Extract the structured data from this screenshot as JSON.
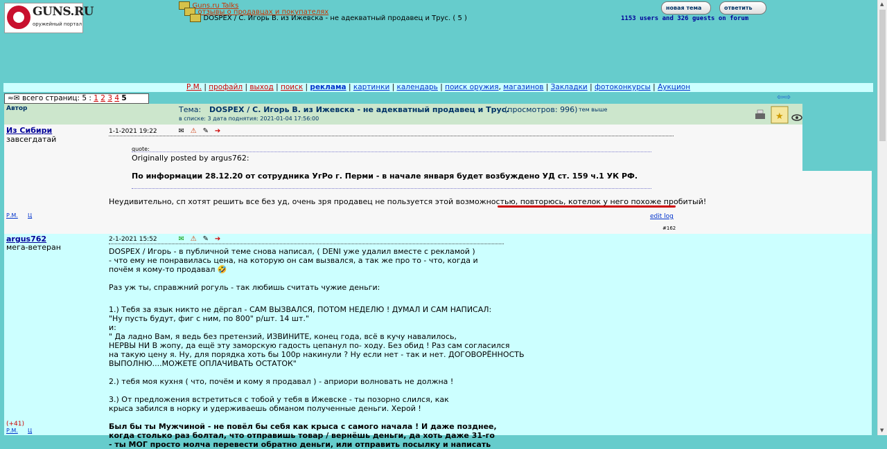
{
  "logo": {
    "brand": "GUNS.RU",
    "tagline": "оружейный портал"
  },
  "breadcrumb": {
    "level1": "Guns.ru Talks",
    "level2": "отзывы о продавцах и покупателях",
    "level3": "DOSPEX / С. Игорь В. из Ижевска - не адекватный продавец и Трус. ( 5 )"
  },
  "header_buttons": {
    "new_topic": "новая тема",
    "reply": "ответить"
  },
  "online": "1153 users and 326 guests on forum",
  "nav": [
    "Р.М.",
    "профайл",
    "выход",
    "поиск",
    "реклама",
    "картинки",
    "календарь",
    "поиск оружия",
    "магазинов",
    "Закладки",
    "фотоконкурсы",
    "Аукцион"
  ],
  "pages": {
    "label": "всего страниц: 5 :",
    "links": [
      "1",
      "2",
      "3",
      "4"
    ],
    "current": "5"
  },
  "topic": {
    "author_col": "Автор",
    "label": "Тема:",
    "title": "DOSPEX / С. Игорь В. из Ижевска - не адекватный продавец и Трус.",
    "views": "(просмотров: 996)",
    "above": "тем выше",
    "meta": "в списке: 3 дата поднятия: 2021-01-04 17:56:00"
  },
  "post1": {
    "author": "Из Сибири",
    "rank": "завсегдатай",
    "date": "1-1-2021 19:22",
    "quote_label": "quote:",
    "quote_by": "Originally posted by argus762:",
    "quote_text": "По информации 28.12.20 от сотрудника УгРо г. Перми - в начале января будет возбуждено УД ст. 159 ч.1 УК РФ.",
    "text_a": "Неудивительно, сп хотят решить все без уд, очень зря продавец не пользуется этой возможностью, ",
    "text_b": "повторюсь, котелок у него похоже пробитый!",
    "edit_log": "edit log",
    "num": "#162",
    "pm": "Р.М.",
    "cite": "Ц"
  },
  "post2": {
    "author": "argus762",
    "rank": "мега-ветеран",
    "date": "2-1-2021 15:52",
    "p1": "DOSPEX / Игорь - в публичной теме снова написал, ( DENI уже удалил вместе с рекламой )",
    "p2": "- что ему не понравилась цена, на которую он сам вызвался, а так же про то - что, когда и",
    "p3": "почём я кому-то продавал 🤣",
    "p4": "Раз уж ты, справжний рогуль - так любишь считать чужие деньги:",
    "p5": "1.) Тебя за язык никто не дёргал - САМ ВЫЗВАЛСЯ, ПОТОМ НЕДЕЛЮ ! ДУМАЛ И САМ НАПИСАЛ:",
    "p6": "\"Ну пусть будут, фиг с ним, по 800\" р/шт. 14 шт.\"",
    "p7": "и:",
    "p8": "\" Да ладно Вам, я ведь без претензий, ИЗВИНИТЕ, конец года, всё в кучу навалилось,",
    "p9": "НЕРВЫ НИ В жопу, да ещё эту заморскую гадость цепанул по- ходу. Без обид ! Раз сам согласился",
    "p10": "на такую цену я. Ну, для порядка хоть бы 100р накинули ? Ну если нет - так и нет. ДОГОВОРЁННОСТЬ",
    "p11": "ВЫПОЛНЮ....МОЖЕТЕ ОПЛАЧИВАТЬ ОСТАТОК\"",
    "p12": "2.) тебя моя кухня ( что, почём и кому я продавал ) - априори волновать не должна !",
    "p13": "3.) От предложения встретиться с тобой у тебя в Ижевске - ты позорно слился, как",
    "p14": "крыса забился в норку и удерживаешь обманом полученные деньги. Херой !",
    "b1": "Был бы ты Мужчиной - не повёл бы себя как крыса с самого начала ! И даже позднее,",
    "b2": "когда столько раз болтал, что отправишь товар / вернёшь деньги, да хоть даже 31-го",
    "b3": "- ты МОГ просто молча перевести обратно деньги, или отправить посылку и написать",
    "rating": "(+41)",
    "pm": "Р.М.",
    "cite": "Ц"
  },
  "colors": {
    "background": "#66cccc",
    "nav_bg": "#ccffff",
    "post1_bg": "#f7f7f7",
    "post2_bg": "#ccffff",
    "underline": "#cc0000"
  }
}
